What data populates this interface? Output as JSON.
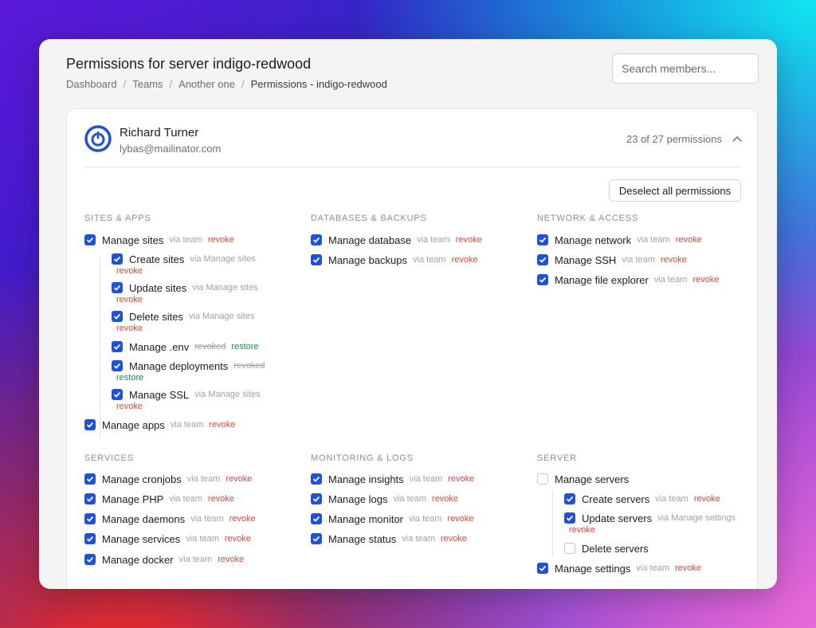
{
  "header": {
    "title": "Permissions for server indigo-redwood",
    "breadcrumb": [
      "Dashboard",
      "Teams",
      "Another one",
      "Permissions - indigo-redwood"
    ],
    "search_placeholder": "Search members..."
  },
  "member": {
    "name": "Richard Turner",
    "email": "lybas@mailinator.com",
    "permission_count": "23 of 27 permissions",
    "deselect_label": "Deselect all permissions"
  },
  "labels": {
    "via_team": "via team",
    "revoke": "revoke",
    "revoked": "revoked",
    "restore": "restore"
  },
  "sections": {
    "sites": {
      "title": "SITES & APPS",
      "manage_sites": "Manage sites",
      "create_sites": "Create sites",
      "update_sites": "Update sites",
      "delete_sites": "Delete sites",
      "manage_env": "Manage .env",
      "manage_deployments": "Manage deployments",
      "manage_ssl": "Manage SSL",
      "manage_apps": "Manage apps",
      "via_manage_sites": "via Manage sites"
    },
    "databases": {
      "title": "DATABASES & BACKUPS",
      "manage_database": "Manage database",
      "manage_backups": "Manage backups"
    },
    "network": {
      "title": "NETWORK & ACCESS",
      "manage_network": "Manage network",
      "manage_ssh": "Manage SSH",
      "manage_file_explorer": "Manage file explorer"
    },
    "services": {
      "title": "SERVICES",
      "manage_cronjobs": "Manage cronjobs",
      "manage_php": "Manage PHP",
      "manage_daemons": "Manage daemons",
      "manage_services": "Manage services",
      "manage_docker": "Manage docker"
    },
    "monitoring": {
      "title": "MONITORING & LOGS",
      "manage_insights": "Manage insights",
      "manage_logs": "Manage logs",
      "manage_monitor": "Manage monitor",
      "manage_status": "Manage status"
    },
    "server": {
      "title": "SERVER",
      "manage_servers": "Manage servers",
      "create_servers": "Create servers",
      "update_servers": "Update servers",
      "delete_servers": "Delete servers",
      "manage_settings": "Manage settings",
      "via_manage_settings": "via Manage settings"
    }
  },
  "colors": {
    "accent": "#1f52d6",
    "revoke": "#e0483c",
    "restore": "#1f8a4a"
  }
}
